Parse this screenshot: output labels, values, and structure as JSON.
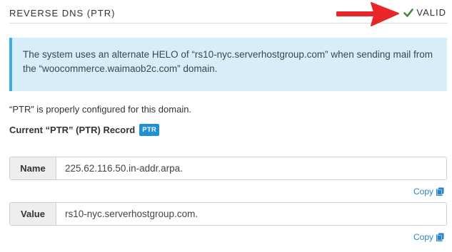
{
  "header": {
    "title": "REVERSE DNS (PTR)",
    "status": "VALID",
    "status_color": "#3c8a3c"
  },
  "alert": {
    "message": "The system uses an alternate HELO of “rs10-nyc.serverhostgroup.com” when sending mail from the “woocommerce.waimaob2c.com” domain."
  },
  "status_text": "“PTR” is properly configured for this domain.",
  "record": {
    "label": "Current “PTR” (PTR) Record",
    "badge": "PTR"
  },
  "fields": [
    {
      "label": "Name",
      "value": "225.62.116.50.in-addr.arpa.",
      "copy_label": "Copy"
    },
    {
      "label": "Value",
      "value": "rs10-nyc.serverhostgroup.com.",
      "copy_label": "Copy"
    }
  ],
  "icons": {
    "check": "check-icon",
    "copy": "copy-icon",
    "arrow": "red-arrow-icon"
  },
  "colors": {
    "accent": "#1f90d6",
    "alert_bg": "#d9edf8",
    "arrow": "#e8262a"
  }
}
